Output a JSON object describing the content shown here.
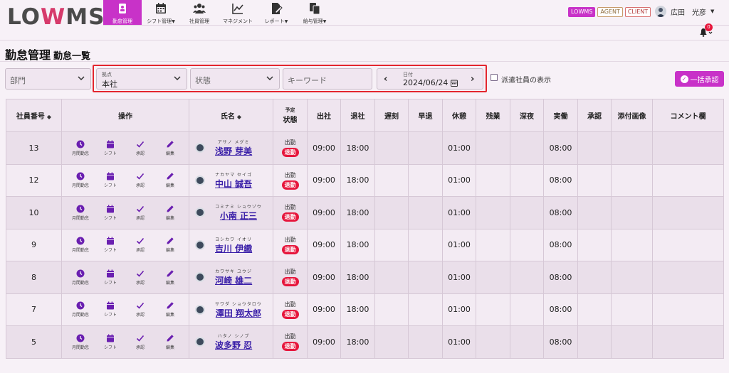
{
  "app": {
    "logo_prefix": "LO",
    "logo_w": "W",
    "logo_suffix": "MS"
  },
  "nav": [
    {
      "label": "勤怠管理",
      "icon": "badge-icon",
      "active": true
    },
    {
      "label": "シフト管理",
      "icon": "calendar-icon",
      "dropdown": true
    },
    {
      "label": "社員管理",
      "icon": "users-icon"
    },
    {
      "label": "マネジメント",
      "icon": "chart-line-icon"
    },
    {
      "label": "レポート",
      "icon": "report-edit-icon",
      "dropdown": true
    },
    {
      "label": "給与管理",
      "icon": "copy-icon",
      "dropdown": true
    }
  ],
  "system_tags": {
    "lowms": "LOWMS",
    "agent": "AGENT",
    "client": "CLIENT"
  },
  "user": {
    "name": "広田　光彦"
  },
  "notifications": {
    "count": "0"
  },
  "page": {
    "title": "勤怠管理",
    "subtitle": "勤怠一覧"
  },
  "filters": {
    "department_placeholder": "部門",
    "base_label": "拠点",
    "base_value": "本社",
    "status_placeholder": "状態",
    "keyword_placeholder": "キーワード",
    "date_label": "日付",
    "date_value": "2024/06/24",
    "dispatch_label": "派遣社員の表示"
  },
  "actions": {
    "bulk_approve": "一括承認"
  },
  "table": {
    "headers": {
      "employee_no": "社員番号",
      "operations": "操作",
      "name": "氏名",
      "plan_top": "予定",
      "plan_bottom": "状態",
      "clock_in": "出社",
      "clock_out": "退社",
      "late": "遅刻",
      "early": "早退",
      "break": "休憩",
      "overtime": "残業",
      "night": "深夜",
      "actual": "実働",
      "approval": "承認",
      "attachment": "添付画像",
      "comment": "コメント欄"
    },
    "op_labels": {
      "monthly": "月間勤怠",
      "shift": "シフト",
      "approve": "承認",
      "edit": "編集"
    },
    "rows": [
      {
        "no": "13",
        "kana": "アサノ メグミ",
        "name": "浅野 芽美",
        "plan": "出勤",
        "status": "退勤",
        "in": "09:00",
        "out": "18:00",
        "late": "",
        "early": "",
        "break": "01:00",
        "overtime": "",
        "night": "",
        "actual": "08:00",
        "approval": "",
        "attachment": "",
        "comment": ""
      },
      {
        "no": "12",
        "kana": "ナカヤマ セイゴ",
        "name": "中山 誠吾",
        "plan": "出勤",
        "status": "退勤",
        "in": "09:00",
        "out": "18:00",
        "late": "",
        "early": "",
        "break": "01:00",
        "overtime": "",
        "night": "",
        "actual": "08:00",
        "approval": "",
        "attachment": "",
        "comment": ""
      },
      {
        "no": "10",
        "kana": "コミナミ ショウゾウ",
        "name": "小南 正三",
        "plan": "出勤",
        "status": "退勤",
        "in": "09:00",
        "out": "18:00",
        "late": "",
        "early": "",
        "break": "01:00",
        "overtime": "",
        "night": "",
        "actual": "08:00",
        "approval": "",
        "attachment": "",
        "comment": ""
      },
      {
        "no": "9",
        "kana": "ヨシカワ イオリ",
        "name": "吉川 伊織",
        "plan": "出勤",
        "status": "退勤",
        "in": "09:00",
        "out": "18:00",
        "late": "",
        "early": "",
        "break": "01:00",
        "overtime": "",
        "night": "",
        "actual": "08:00",
        "approval": "",
        "attachment": "",
        "comment": ""
      },
      {
        "no": "8",
        "kana": "カワサキ ユウジ",
        "name": "河崎 雄二",
        "plan": "出勤",
        "status": "退勤",
        "in": "09:00",
        "out": "18:00",
        "late": "",
        "early": "",
        "break": "01:00",
        "overtime": "",
        "night": "",
        "actual": "08:00",
        "approval": "",
        "attachment": "",
        "comment": ""
      },
      {
        "no": "7",
        "kana": "サワダ ショウタロウ",
        "name": "澤田 翔太郎",
        "plan": "出勤",
        "status": "退勤",
        "in": "09:00",
        "out": "18:00",
        "late": "",
        "early": "",
        "break": "01:00",
        "overtime": "",
        "night": "",
        "actual": "08:00",
        "approval": "",
        "attachment": "",
        "comment": ""
      },
      {
        "no": "5",
        "kana": "ハタノ シノブ",
        "name": "波多野 忍",
        "plan": "出勤",
        "status": "退勤",
        "in": "09:00",
        "out": "18:00",
        "late": "",
        "early": "",
        "break": "01:00",
        "overtime": "",
        "night": "",
        "actual": "08:00",
        "approval": "",
        "attachment": "",
        "comment": ""
      }
    ]
  },
  "colors": {
    "accent": "#c832c8",
    "alert": "#e6163c",
    "highlight_border": "#e3262e",
    "link": "#3a1fa8"
  }
}
